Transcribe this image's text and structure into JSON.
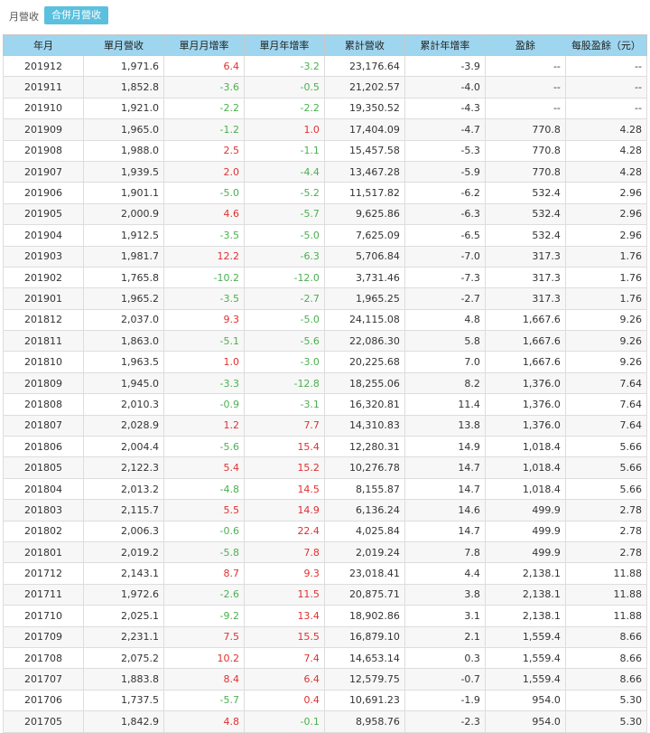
{
  "tabs": {
    "monthly": "月營收",
    "consolidated": "合併月營收"
  },
  "columns": [
    "年月",
    "單月營收",
    "單月月增率",
    "單月年增率",
    "累計營收",
    "累計年增率",
    "盈餘",
    "每股盈餘（元）"
  ],
  "colors": {
    "header_bg": "#9fd6ef",
    "active_tab": "#5bc0de",
    "positive": "#e03030",
    "negative": "#4caf50"
  },
  "rows": [
    [
      "201912",
      "1,971.6",
      "6.4",
      "-3.2",
      "23,176.64",
      "-3.9",
      "--",
      "--"
    ],
    [
      "201911",
      "1,852.8",
      "-3.6",
      "-0.5",
      "21,202.57",
      "-4.0",
      "--",
      "--"
    ],
    [
      "201910",
      "1,921.0",
      "-2.2",
      "-2.2",
      "19,350.52",
      "-4.3",
      "--",
      "--"
    ],
    [
      "201909",
      "1,965.0",
      "-1.2",
      "1.0",
      "17,404.09",
      "-4.7",
      "770.8",
      "4.28"
    ],
    [
      "201908",
      "1,988.0",
      "2.5",
      "-1.1",
      "15,457.58",
      "-5.3",
      "770.8",
      "4.28"
    ],
    [
      "201907",
      "1,939.5",
      "2.0",
      "-4.4",
      "13,467.28",
      "-5.9",
      "770.8",
      "4.28"
    ],
    [
      "201906",
      "1,901.1",
      "-5.0",
      "-5.2",
      "11,517.82",
      "-6.2",
      "532.4",
      "2.96"
    ],
    [
      "201905",
      "2,000.9",
      "4.6",
      "-5.7",
      "9,625.86",
      "-6.3",
      "532.4",
      "2.96"
    ],
    [
      "201904",
      "1,912.5",
      "-3.5",
      "-5.0",
      "7,625.09",
      "-6.5",
      "532.4",
      "2.96"
    ],
    [
      "201903",
      "1,981.7",
      "12.2",
      "-6.3",
      "5,706.84",
      "-7.0",
      "317.3",
      "1.76"
    ],
    [
      "201902",
      "1,765.8",
      "-10.2",
      "-12.0",
      "3,731.46",
      "-7.3",
      "317.3",
      "1.76"
    ],
    [
      "201901",
      "1,965.2",
      "-3.5",
      "-2.7",
      "1,965.25",
      "-2.7",
      "317.3",
      "1.76"
    ],
    [
      "201812",
      "2,037.0",
      "9.3",
      "-5.0",
      "24,115.08",
      "4.8",
      "1,667.6",
      "9.26"
    ],
    [
      "201811",
      "1,863.0",
      "-5.1",
      "-5.6",
      "22,086.30",
      "5.8",
      "1,667.6",
      "9.26"
    ],
    [
      "201810",
      "1,963.5",
      "1.0",
      "-3.0",
      "20,225.68",
      "7.0",
      "1,667.6",
      "9.26"
    ],
    [
      "201809",
      "1,945.0",
      "-3.3",
      "-12.8",
      "18,255.06",
      "8.2",
      "1,376.0",
      "7.64"
    ],
    [
      "201808",
      "2,010.3",
      "-0.9",
      "-3.1",
      "16,320.81",
      "11.4",
      "1,376.0",
      "7.64"
    ],
    [
      "201807",
      "2,028.9",
      "1.2",
      "7.7",
      "14,310.83",
      "13.8",
      "1,376.0",
      "7.64"
    ],
    [
      "201806",
      "2,004.4",
      "-5.6",
      "15.4",
      "12,280.31",
      "14.9",
      "1,018.4",
      "5.66"
    ],
    [
      "201805",
      "2,122.3",
      "5.4",
      "15.2",
      "10,276.78",
      "14.7",
      "1,018.4",
      "5.66"
    ],
    [
      "201804",
      "2,013.2",
      "-4.8",
      "14.5",
      "8,155.87",
      "14.7",
      "1,018.4",
      "5.66"
    ],
    [
      "201803",
      "2,115.7",
      "5.5",
      "14.9",
      "6,136.24",
      "14.6",
      "499.9",
      "2.78"
    ],
    [
      "201802",
      "2,006.3",
      "-0.6",
      "22.4",
      "4,025.84",
      "14.7",
      "499.9",
      "2.78"
    ],
    [
      "201801",
      "2,019.2",
      "-5.8",
      "7.8",
      "2,019.24",
      "7.8",
      "499.9",
      "2.78"
    ],
    [
      "201712",
      "2,143.1",
      "8.7",
      "9.3",
      "23,018.41",
      "4.4",
      "2,138.1",
      "11.88"
    ],
    [
      "201711",
      "1,972.6",
      "-2.6",
      "11.5",
      "20,875.71",
      "3.8",
      "2,138.1",
      "11.88"
    ],
    [
      "201710",
      "2,025.1",
      "-9.2",
      "13.4",
      "18,902.86",
      "3.1",
      "2,138.1",
      "11.88"
    ],
    [
      "201709",
      "2,231.1",
      "7.5",
      "15.5",
      "16,879.10",
      "2.1",
      "1,559.4",
      "8.66"
    ],
    [
      "201708",
      "2,075.2",
      "10.2",
      "7.4",
      "14,653.14",
      "0.3",
      "1,559.4",
      "8.66"
    ],
    [
      "201707",
      "1,883.8",
      "8.4",
      "6.4",
      "12,579.75",
      "-0.7",
      "1,559.4",
      "8.66"
    ],
    [
      "201706",
      "1,737.5",
      "-5.7",
      "0.4",
      "10,691.23",
      "-1.9",
      "954.0",
      "5.30"
    ],
    [
      "201705",
      "1,842.9",
      "4.8",
      "-0.1",
      "8,958.76",
      "-2.3",
      "954.0",
      "5.30"
    ]
  ]
}
